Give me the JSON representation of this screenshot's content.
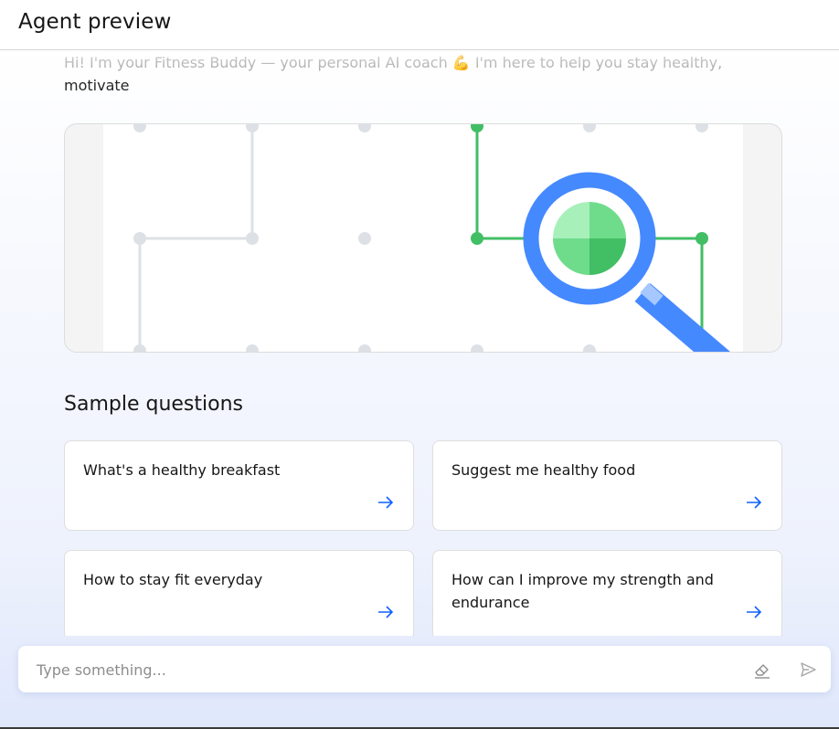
{
  "header": {
    "title": "Agent preview"
  },
  "chat": {
    "greeting_line1": "Hi! I'm your Fitness Buddy — your personal AI coach 💪 I'm here to help you stay healthy,",
    "greeting_line2": "motivate"
  },
  "illustration": {
    "icon": "magnifying-glass-over-network-icon",
    "colors": {
      "accent_blue": "#4589ff",
      "accent_green": "#42be65",
      "node_gray": "#dde1e6"
    }
  },
  "sample_questions": {
    "title": "Sample questions",
    "items": [
      {
        "text": "What's a healthy breakfast",
        "icon": "arrow-right-icon"
      },
      {
        "text": "Suggest me healthy food",
        "icon": "arrow-right-icon"
      },
      {
        "text": "How to stay fit everyday",
        "icon": "arrow-right-icon"
      },
      {
        "text": "How can I improve my strength and endurance",
        "icon": "arrow-right-icon"
      }
    ]
  },
  "input": {
    "placeholder": "Type something...",
    "value": "",
    "clear_icon": "eraser-icon",
    "send_icon": "send-icon"
  },
  "theme": {
    "accent": "#0f62fe"
  }
}
